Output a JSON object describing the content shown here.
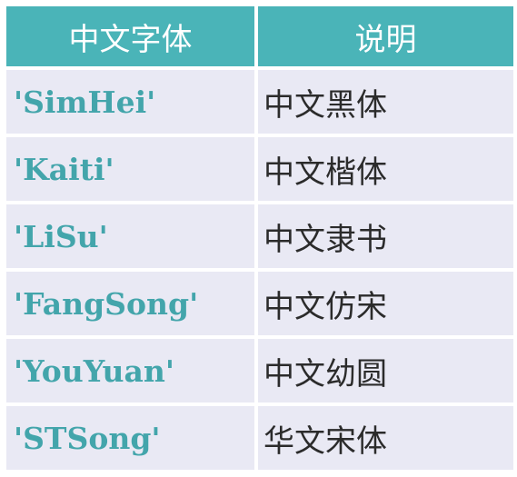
{
  "table": {
    "headers": {
      "font": "中文字体",
      "description": "说明"
    },
    "rows": [
      {
        "font": "'SimHei'",
        "description": "中文黑体"
      },
      {
        "font": "'Kaiti'",
        "description": "中文楷体"
      },
      {
        "font": "'LiSu'",
        "description": "中文隶书"
      },
      {
        "font": "'FangSong'",
        "description": "中文仿宋"
      },
      {
        "font": "'YouYuan'",
        "description": "中文幼圆"
      },
      {
        "font": "'STSong'",
        "description": "华文宋体"
      }
    ]
  },
  "colors": {
    "header_bg": "#4ab4b8",
    "row_bg": "#e9e9f4",
    "font_name_text": "#43a5ab",
    "description_text": "#2b2b2b"
  }
}
